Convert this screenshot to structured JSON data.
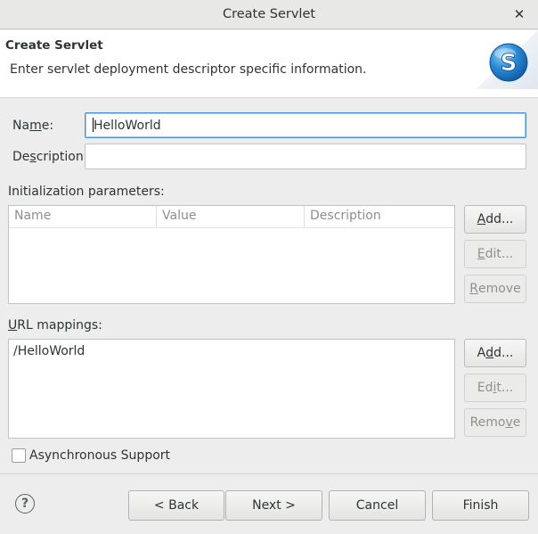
{
  "window": {
    "title": "Create Servlet",
    "close_glyph": "✕"
  },
  "banner": {
    "heading": "Create Servlet",
    "description": "Enter servlet deployment descriptor specific information.",
    "logo_letter": "S"
  },
  "form": {
    "name_label_pre": "Na",
    "name_label_mnemonic": "m",
    "name_label_post": "e:",
    "name_value": "HelloWorld",
    "description_label_pre": "De",
    "description_label_mnemonic": "s",
    "description_label_post": "cription:",
    "description_value": ""
  },
  "init_params": {
    "label": "Initialization parameters:",
    "columns": [
      "Name",
      "Value",
      "Description"
    ],
    "rows": [],
    "add_pre": "",
    "add_mnemonic": "A",
    "add_post": "dd...",
    "edit_pre": "",
    "edit_mnemonic": "E",
    "edit_post": "dit...",
    "remove_pre": "",
    "remove_mnemonic": "R",
    "remove_post": "emove"
  },
  "url_mappings": {
    "label_mnemonic": "U",
    "label_post": "RL mappings:",
    "items": [
      "/HelloWorld"
    ],
    "add_pre": "A",
    "add_mnemonic": "d",
    "add_post": "d...",
    "edit_pre": "Ed",
    "edit_mnemonic": "i",
    "edit_post": "t...",
    "remove_pre": "Remo",
    "remove_mnemonic": "v",
    "remove_post": "e"
  },
  "async": {
    "label": "Asynchronous Support",
    "checked": false
  },
  "footer": {
    "help_glyph": "?",
    "back": "< Back",
    "next": "Next >",
    "cancel": "Cancel",
    "finish": "Finish"
  },
  "colors": {
    "accent": "#4a90d9",
    "logo_blue": "#2a8ad6"
  }
}
